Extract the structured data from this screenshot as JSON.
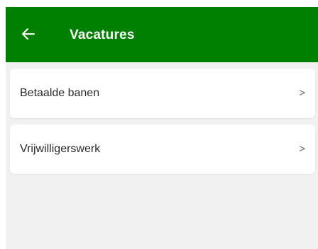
{
  "appbar": {
    "title": "Vacatures",
    "back_icon": "arrow-left-icon",
    "background": "#008000"
  },
  "list": {
    "items": [
      {
        "label": "Betaalde banen",
        "icon": "chevron-right-icon",
        "chevron": ">"
      },
      {
        "label": "Vrijwilligerswerk",
        "icon": "chevron-right-icon",
        "chevron": ">"
      }
    ]
  },
  "colors": {
    "page_background": "#f1f1f1",
    "card_background": "#ffffff"
  }
}
